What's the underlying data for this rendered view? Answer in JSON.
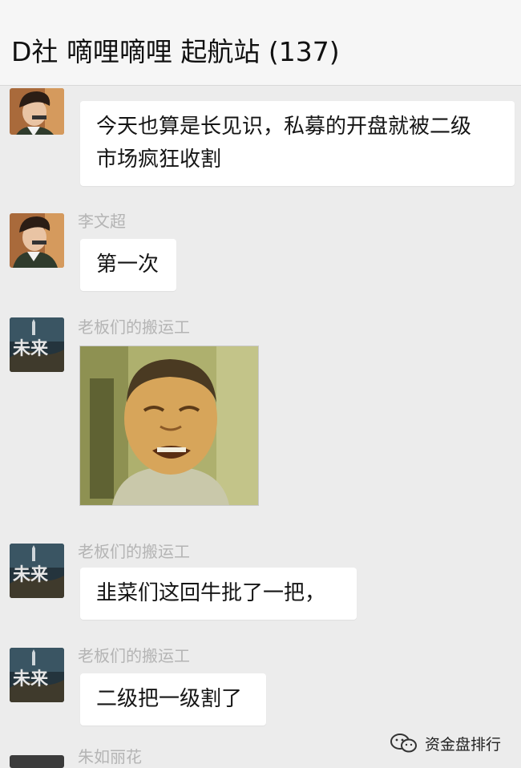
{
  "header": {
    "title": "D社 嘀哩嘀哩 起航站 (137)"
  },
  "messages": [
    {
      "sender": "",
      "text_lines": [
        "今天也算是长见识，私募的开盘就被二级",
        "市场疯狂收割"
      ]
    },
    {
      "sender": "李文超",
      "text_lines": [
        "第一次"
      ]
    },
    {
      "sender": "老板们的搬运工",
      "sticker": "crying-man-sticker"
    },
    {
      "sender": "老板们的搬运工",
      "text_lines": [
        "韭菜们这回牛批了一把，"
      ]
    },
    {
      "sender": "老板们的搬运工",
      "text_lines": [
        "二级把一级割了"
      ]
    },
    {
      "sender": "朱如丽花"
    }
  ],
  "watermark": {
    "text": "资金盘排行",
    "icon": "wechat-official-account-icon"
  },
  "colors": {
    "background": "#ececec",
    "bubble": "#ffffff",
    "sender": "#b4b4b4",
    "header": "#f6f6f6"
  }
}
